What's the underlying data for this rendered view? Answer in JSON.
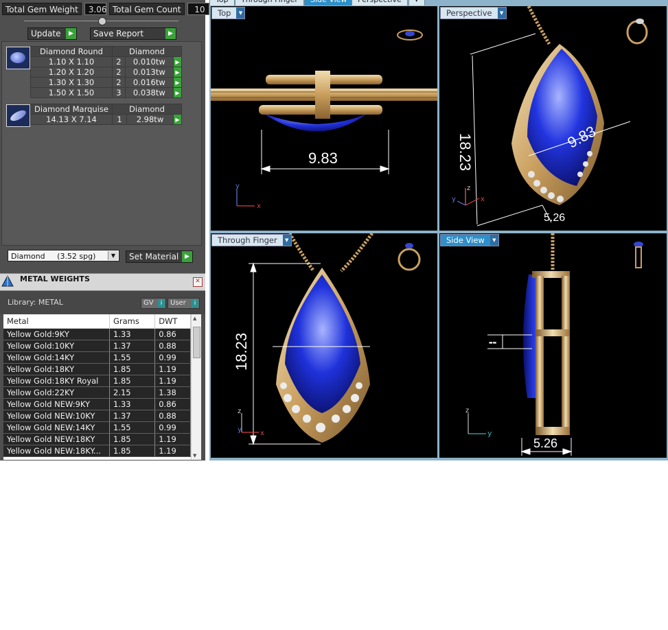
{
  "stats": {
    "total_gem_weight_label": "Total Gem Weight",
    "total_gem_weight_value": "3.06",
    "total_gem_count_label": "Total Gem Count",
    "total_gem_count_value": "10"
  },
  "toolbar": {
    "update_label": "Update",
    "save_report_label": "Save Report"
  },
  "gems": {
    "round": {
      "header_name": "Diamond Round",
      "header_type": "Diamond",
      "rows": [
        {
          "size": "1.10 X 1.10",
          "qty": "2",
          "weight": "0.010tw"
        },
        {
          "size": "1.20 X 1.20",
          "qty": "2",
          "weight": "0.013tw"
        },
        {
          "size": "1.30 X 1.30",
          "qty": "2",
          "weight": "0.016tw"
        },
        {
          "size": "1.50 X 1.50",
          "qty": "3",
          "weight": "0.038tw"
        }
      ]
    },
    "marquise": {
      "header_name": "Diamond Marquise",
      "header_type": "Diamond",
      "rows": [
        {
          "size": "14.13 X 7.14",
          "qty": "1",
          "weight": "2.98tw"
        }
      ]
    }
  },
  "material": {
    "selected": "Diamond     (3.52 spg)",
    "set_material_label": "Set Material"
  },
  "metal_weights": {
    "title": "METAL WEIGHTS",
    "library_label": "Library: METAL",
    "gv_label": "GV",
    "user_label": "User",
    "columns": [
      "Metal",
      "Grams",
      "DWT"
    ],
    "rows": [
      [
        "Yellow Gold:9KY",
        "1.33",
        "0.86"
      ],
      [
        "Yellow Gold:10KY",
        "1.37",
        "0.88"
      ],
      [
        "Yellow Gold:14KY",
        "1.55",
        "0.99"
      ],
      [
        "Yellow Gold:18KY",
        "1.85",
        "1.19"
      ],
      [
        "Yellow Gold:18KY Royal",
        "1.85",
        "1.19"
      ],
      [
        "Yellow Gold:22KY",
        "2.15",
        "1.38"
      ],
      [
        "Yellow Gold NEW:9KY",
        "1.33",
        "0.86"
      ],
      [
        "Yellow Gold NEW:10KY",
        "1.37",
        "0.88"
      ],
      [
        "Yellow Gold NEW:14KY",
        "1.55",
        "0.99"
      ],
      [
        "Yellow Gold NEW:18KY",
        "1.85",
        "1.19"
      ],
      [
        "Yellow Gold NEW:18KY...",
        "1.85",
        "1.19"
      ]
    ]
  },
  "view_tabs": [
    "Top",
    "Through Finger",
    "Side View",
    "Perspective"
  ],
  "viewports": {
    "top": {
      "label": "Top",
      "dimension": "9.83"
    },
    "perspective": {
      "label": "Perspective",
      "dimension_a": "18.23",
      "dimension_b": "9.83",
      "dimension_c": "5.26"
    },
    "through_finger": {
      "label": "Through Finger",
      "dimension": "18.23"
    },
    "side_view": {
      "label": "Side View",
      "dimension": "5.26"
    }
  },
  "axis_labels": {
    "x": "x",
    "y": "y",
    "z": "z"
  },
  "colors": {
    "gold": "#d9b57a",
    "sapphire": "#1d2fd0",
    "panel": "#4f4f4f",
    "accent_green": "#3aa23a"
  }
}
